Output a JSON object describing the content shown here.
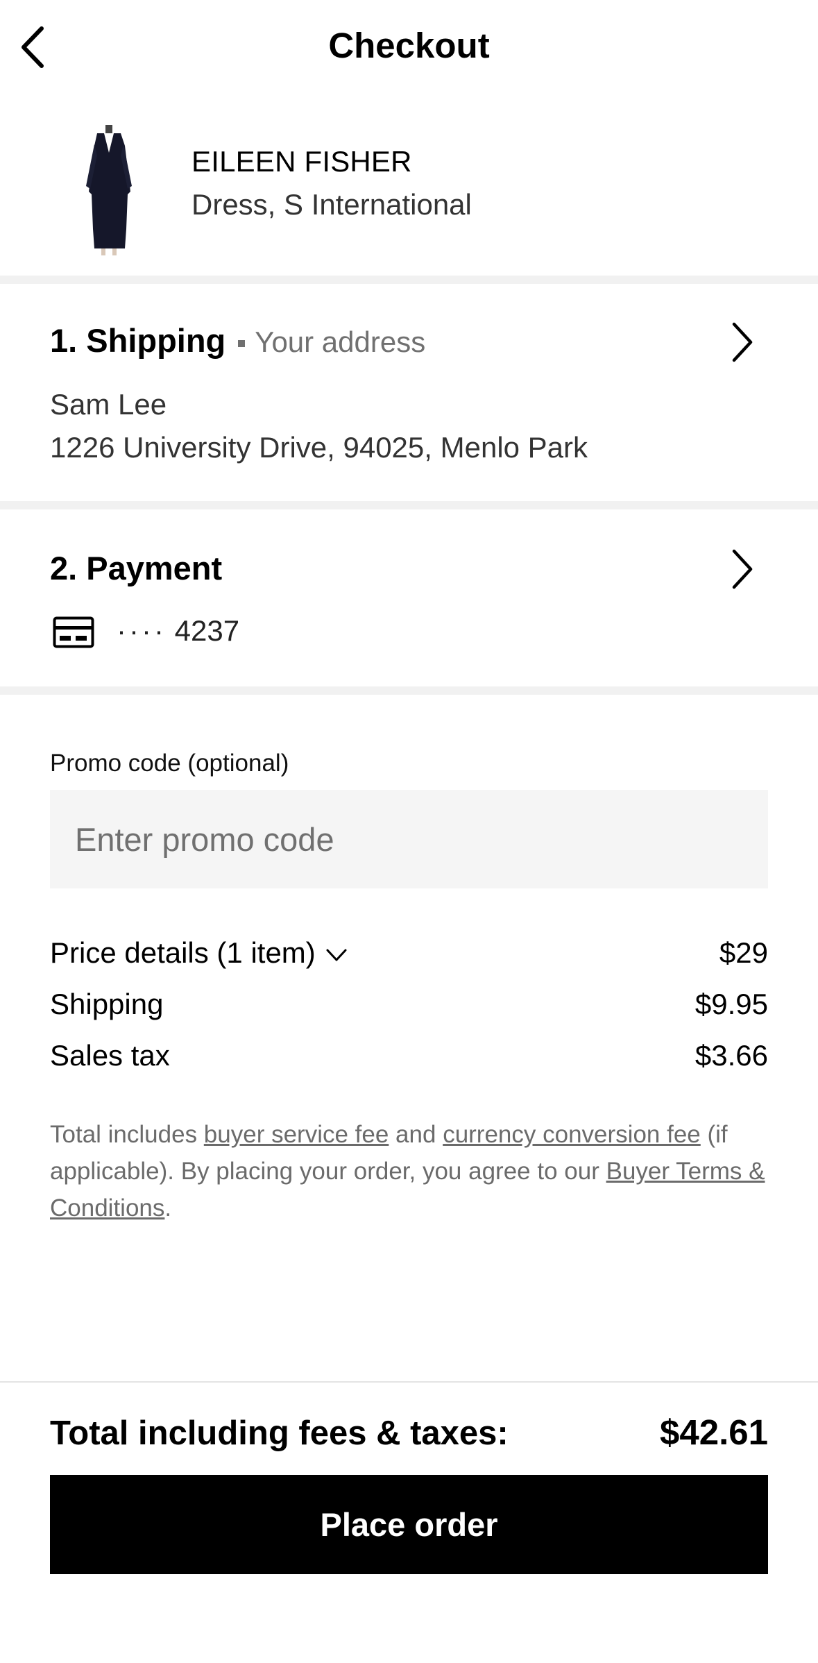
{
  "header": {
    "title": "Checkout",
    "back_icon": "chevron-left-icon"
  },
  "product": {
    "brand": "EILEEN FISHER",
    "description": "Dress, S International"
  },
  "shipping": {
    "title": "1. Shipping",
    "subtitle": "Your address",
    "name": "Sam Lee",
    "address": "1226 University Drive, 94025, Menlo Park"
  },
  "payment": {
    "title": "2. Payment",
    "card_mask": "····",
    "card_last4": "4237",
    "card_icon": "credit-card-icon"
  },
  "promo": {
    "label": "Promo code (optional)",
    "placeholder": "Enter promo code",
    "value": ""
  },
  "price_details": {
    "label": "Price details (1 item)",
    "amount": "$29",
    "shipping_label": "Shipping",
    "shipping_amount": "$9.95",
    "tax_label": "Sales tax",
    "tax_amount": "$3.66"
  },
  "legal": {
    "t1": "Total includes ",
    "link_service_fee": "buyer service fee",
    "t2": " and ",
    "link_currency_fee": "currency conversion fee",
    "t3": " (if applicable). By placing your order, you agree to our ",
    "link_terms": "Buyer Terms & Conditions",
    "t4": "."
  },
  "footer": {
    "total_label": "Total including fees & taxes:",
    "total_value": "$42.61",
    "place_order_label": "Place order"
  },
  "colors": {
    "background": "#ffffff",
    "text": "#000000",
    "muted": "#707070",
    "divider": "#f1f1f1",
    "input_bg": "#f5f5f5",
    "button_bg": "#000000",
    "button_text": "#ffffff"
  }
}
